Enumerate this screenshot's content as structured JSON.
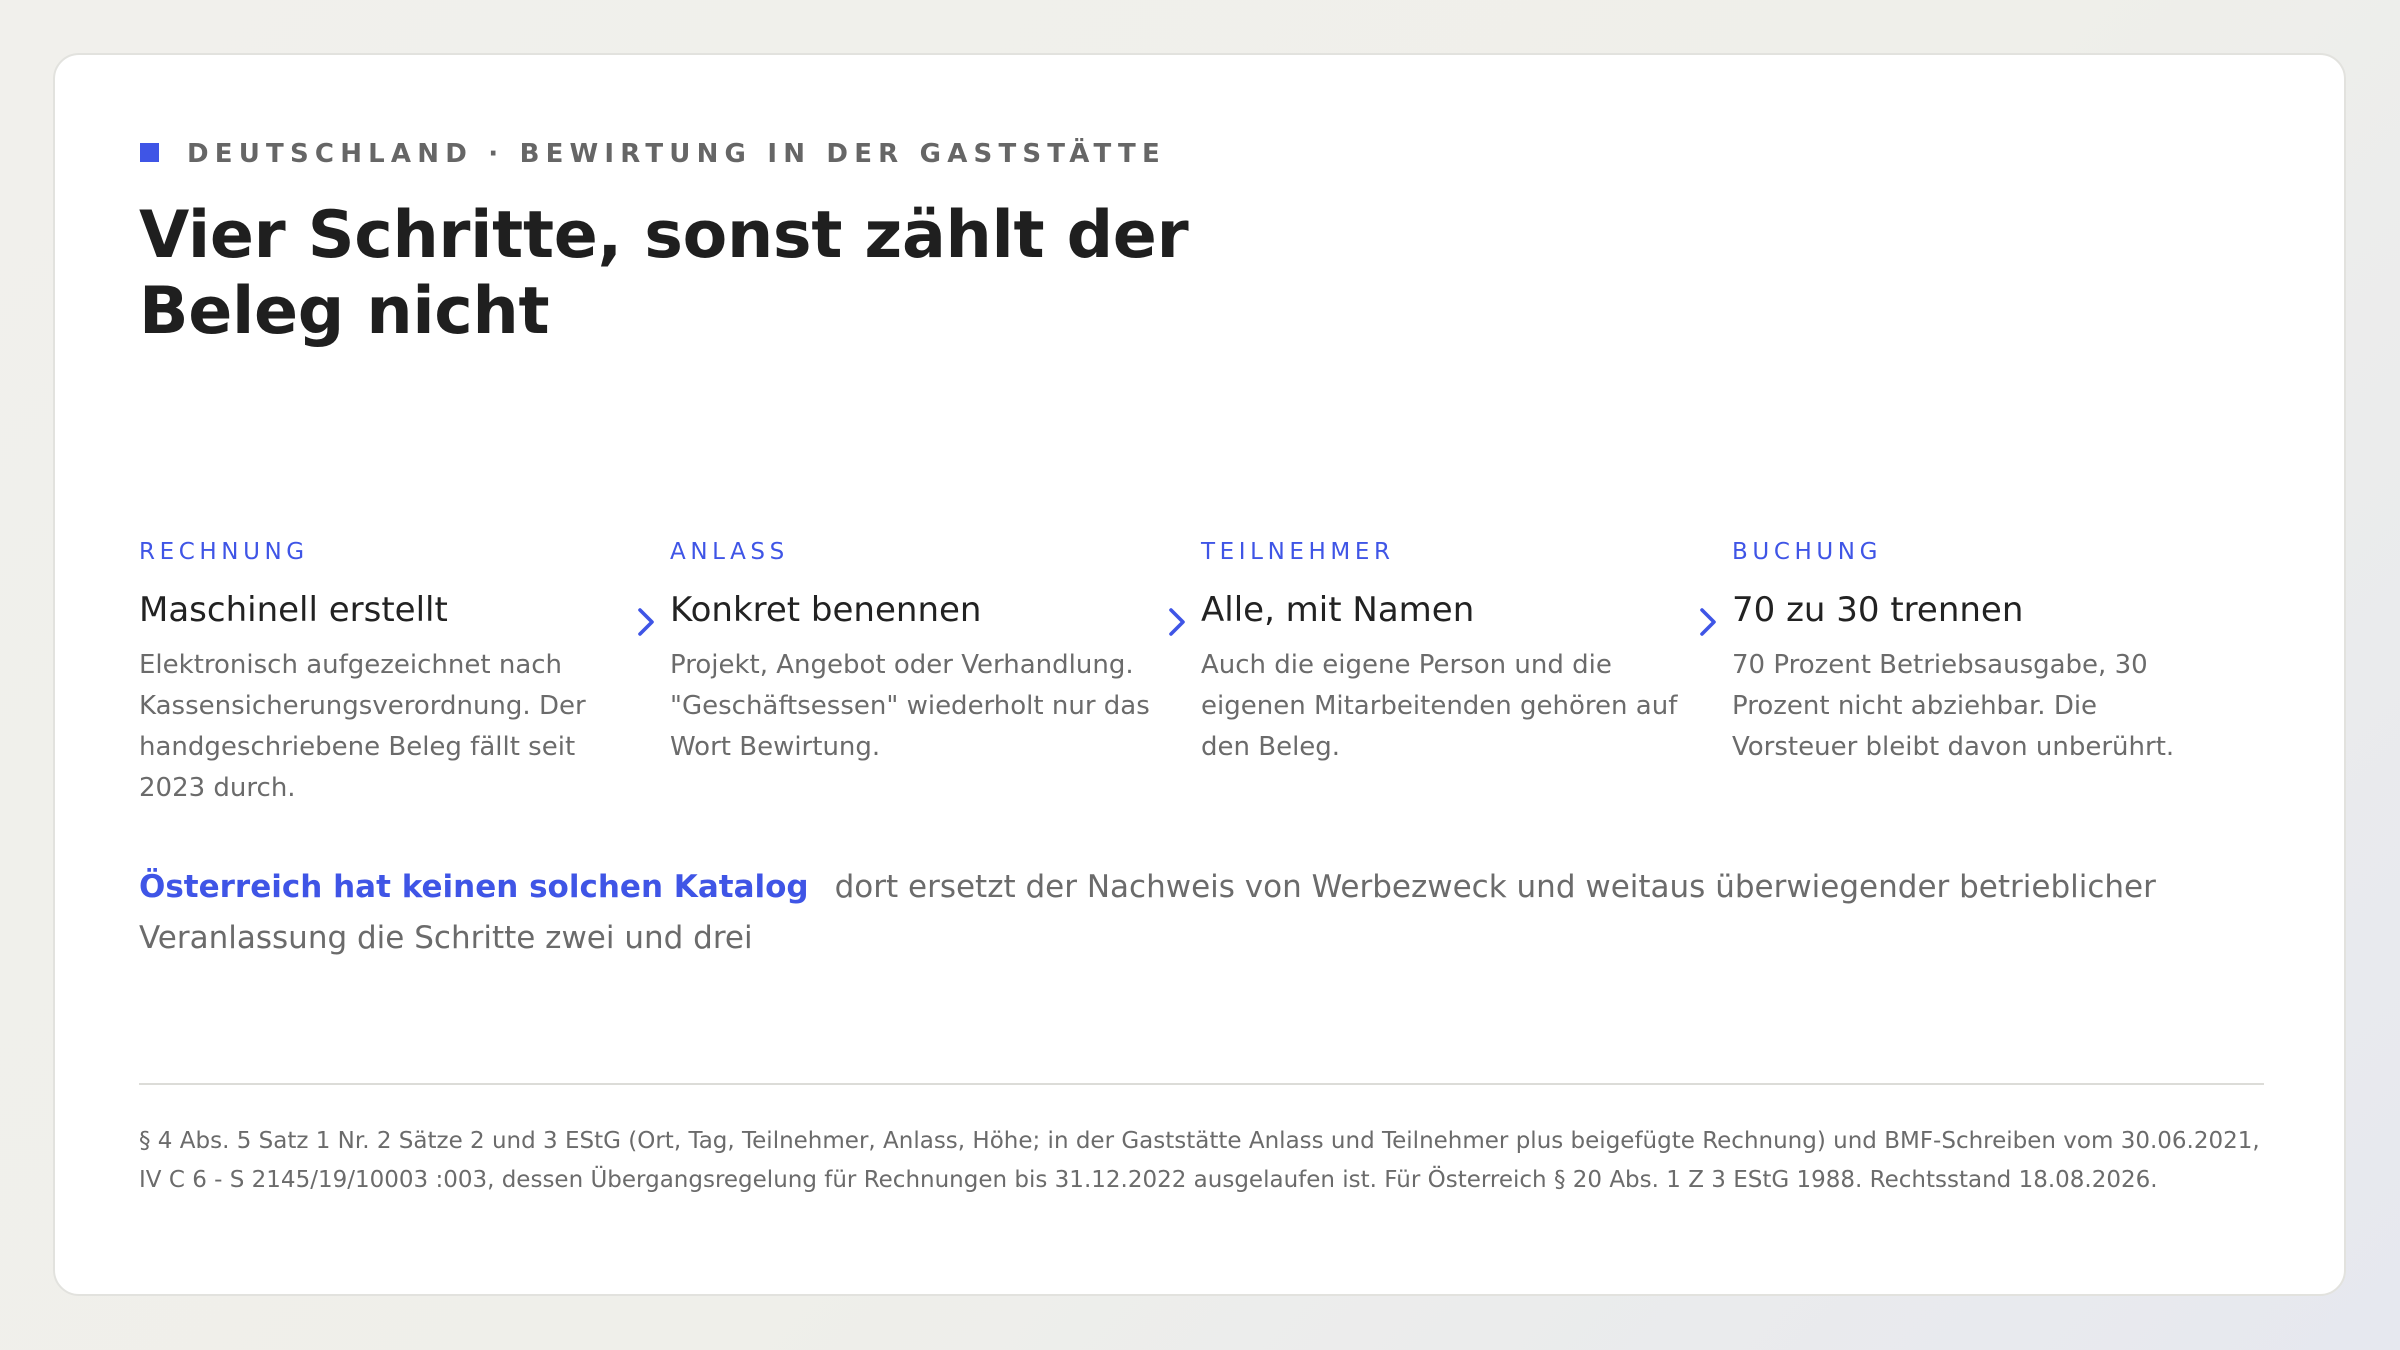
{
  "header": {
    "eyebrow": "DEUTSCHLAND · BEWIRTUNG IN DER GASTSTÄTTE",
    "title": "Vier Schritte, sonst zählt der Beleg nicht"
  },
  "steps": [
    {
      "label": "RECHNUNG",
      "title": "Maschinell erstellt",
      "description": "Elektronisch aufgezeichnet nach Kassensicherungsverordnung. Der handgeschriebene Beleg fällt seit 2023 durch."
    },
    {
      "label": "ANLASS",
      "title": "Konkret benennen",
      "description": "Projekt, Angebot oder Verhandlung. \"Geschäftsessen\" wiederholt nur das Wort Bewirtung."
    },
    {
      "label": "TEILNEHMER",
      "title": "Alle, mit Namen",
      "description": "Auch die eigene Person und die eigenen Mitarbeitenden gehören auf den Beleg."
    },
    {
      "label": "BUCHUNG",
      "title": "70 zu 30 trennen",
      "description": "70 Prozent Betriebsausgabe, 30 Prozent nicht abziehbar. Die Vorsteuer bleibt davon unberührt."
    }
  ],
  "note": {
    "highlight": "Österreich hat keinen solchen Katalog",
    "text": "dort ersetzt der Nachweis von Werbezweck und weitaus überwiegender betrieblicher Veranlassung die Schritte zwei und drei"
  },
  "footnote": "§ 4 Abs. 5 Satz 1 Nr. 2 Sätze 2 und 3 EStG (Ort, Tag, Teilnehmer, Anlass, Höhe; in der Gaststätte Anlass und Teilnehmer plus beigefügte Rechnung) und BMF-Schreiben vom 30.06.2021, IV C 6 - S 2145/19/10003 :003, dessen Übergangsregelung für Rechnungen bis 31.12.2022 ausgelaufen ist. Für Österreich § 20 Abs. 1 Z 3 EStG 1988. Rechtsstand 18.08.2026.",
  "colors": {
    "accent": "#3f55e6",
    "heading": "#1f1f1f",
    "muted": "#6b6b6b",
    "eyebrow": "#666666"
  },
  "icons": {
    "square": "accent-square-icon",
    "chevron": "chevron-right-icon"
  }
}
